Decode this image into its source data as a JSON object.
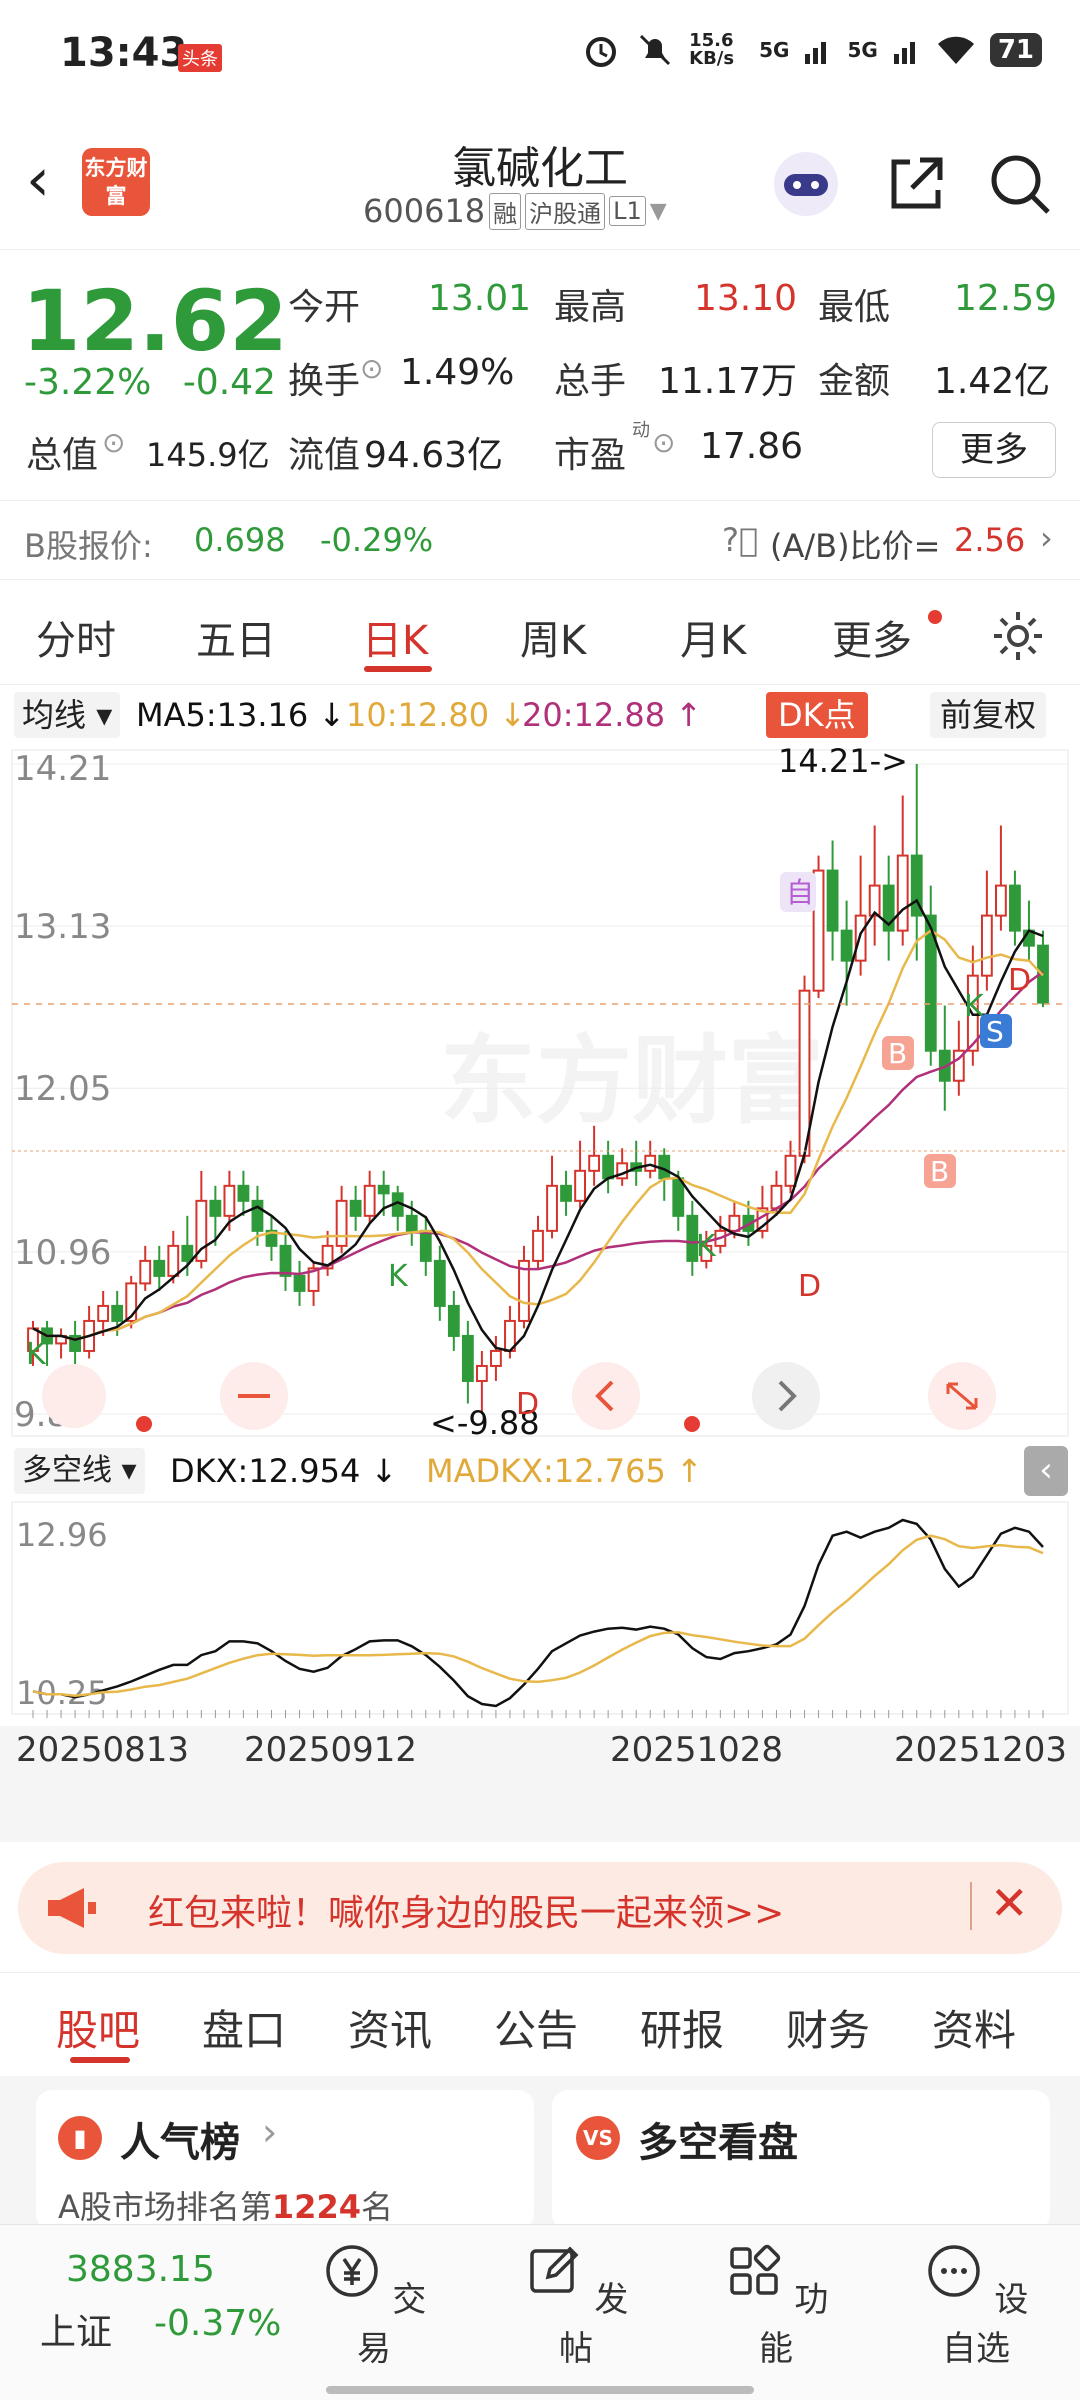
{
  "status": {
    "time": "13:43",
    "badge": "头条",
    "net_speed": "15.6 KB/s",
    "signal1": "5G",
    "signal2": "5G",
    "battery": "71"
  },
  "header": {
    "logo_text": "东方财富",
    "title": "氯碱化工",
    "code": "600618",
    "tag1": "融",
    "tag2": "沪股通",
    "tag3": "L1"
  },
  "quote": {
    "price": "12.62",
    "change_pct": "-3.22%",
    "change_amt": "-0.42",
    "open_label": "今开",
    "open": "13.01",
    "high_label": "最高",
    "high": "13.10",
    "low_label": "最低",
    "low": "12.59",
    "turnover_label": "换手",
    "turnover": "1.49%",
    "volume_label": "总手",
    "volume": "11.17万",
    "amount_label": "金额",
    "amount": "1.42亿",
    "mcap_label": "总值",
    "mcap": "145.9亿",
    "float_label": "流值",
    "float": "94.63亿",
    "pe_label": "市盈",
    "pe_sup": "动",
    "pe": "17.86",
    "more": "更多"
  },
  "bshare": {
    "label": "B股报价:",
    "price": "0.698",
    "change": "-0.29%",
    "ratio_label": "(A/B)比价=",
    "ratio": "2.56"
  },
  "tabs": [
    "分时",
    "五日",
    "日K",
    "周K",
    "月K",
    "更多"
  ],
  "legend": {
    "select": "均线",
    "ma5": "MA5:13.16 ↓",
    "ma10": "10:12.80 ↓",
    "ma20": "20:12.88 ↑",
    "dk": "DK点",
    "fq": "前复权"
  },
  "colors": {
    "red": "#d4342c",
    "green": "#2f9a3a",
    "ma5": "#111111",
    "ma10": "#e8b84a",
    "ma20": "#b0307a"
  },
  "chart_data": {
    "type": "candlestick",
    "y_ticks": [
      "14.21",
      "13.13",
      "12.05",
      "10.96",
      "9.88"
    ],
    "ylim": [
      9.88,
      14.21
    ],
    "annotations": {
      "high": "14.21->",
      "low": "<-9.88",
      "marker_self": "自"
    },
    "signals": [
      "K",
      "D",
      "K",
      "D",
      "K",
      "D",
      "B",
      "K",
      "D",
      "S",
      "B"
    ],
    "dates": [
      "20250813",
      "20250912",
      "20251028",
      "20251203"
    ],
    "indicator": {
      "select": "多空线",
      "dkx_label": "DKX:12.954 ↓",
      "madkx_label": "MADKX:12.765 ↑",
      "y_ticks": [
        "12.96",
        "10.25"
      ]
    },
    "candles": [
      [
        10.3,
        10.45,
        10.2,
        10.5
      ],
      [
        10.45,
        10.35,
        10.2,
        10.5
      ],
      [
        10.35,
        10.4,
        10.25,
        10.45
      ],
      [
        10.4,
        10.3,
        10.2,
        10.5
      ],
      [
        10.3,
        10.5,
        10.25,
        10.6
      ],
      [
        10.5,
        10.6,
        10.4,
        10.7
      ],
      [
        10.6,
        10.5,
        10.4,
        10.7
      ],
      [
        10.5,
        10.75,
        10.45,
        10.8
      ],
      [
        10.75,
        10.9,
        10.7,
        11.0
      ],
      [
        10.9,
        10.8,
        10.7,
        11.0
      ],
      [
        10.8,
        11.0,
        10.75,
        11.1
      ],
      [
        11.0,
        10.9,
        10.8,
        11.2
      ],
      [
        10.9,
        11.3,
        10.85,
        11.5
      ],
      [
        11.3,
        11.2,
        11.0,
        11.4
      ],
      [
        11.2,
        11.4,
        11.1,
        11.5
      ],
      [
        11.4,
        11.3,
        11.2,
        11.5
      ],
      [
        11.3,
        11.1,
        11.0,
        11.4
      ],
      [
        11.1,
        11.0,
        10.9,
        11.2
      ],
      [
        11.0,
        10.8,
        10.7,
        11.1
      ],
      [
        10.8,
        10.7,
        10.6,
        10.9
      ],
      [
        10.7,
        10.85,
        10.6,
        10.9
      ],
      [
        10.85,
        11.0,
        10.8,
        11.1
      ],
      [
        11.0,
        11.3,
        10.95,
        11.4
      ],
      [
        11.3,
        11.2,
        11.1,
        11.4
      ],
      [
        11.2,
        11.4,
        11.15,
        11.5
      ],
      [
        11.4,
        11.35,
        11.2,
        11.5
      ],
      [
        11.35,
        11.2,
        11.1,
        11.4
      ],
      [
        11.2,
        11.1,
        11.0,
        11.3
      ],
      [
        11.1,
        10.9,
        10.8,
        11.2
      ],
      [
        10.9,
        10.6,
        10.5,
        11.0
      ],
      [
        10.6,
        10.4,
        10.3,
        10.7
      ],
      [
        10.4,
        10.1,
        9.95,
        10.5
      ],
      [
        10.1,
        10.2,
        9.88,
        10.3
      ],
      [
        10.2,
        10.3,
        10.1,
        10.4
      ],
      [
        10.3,
        10.5,
        10.25,
        10.6
      ],
      [
        10.5,
        10.9,
        10.45,
        11.0
      ],
      [
        10.9,
        11.1,
        10.85,
        11.2
      ],
      [
        11.1,
        11.4,
        11.05,
        11.6
      ],
      [
        11.4,
        11.3,
        11.2,
        11.5
      ],
      [
        11.3,
        11.5,
        11.25,
        11.7
      ],
      [
        11.5,
        11.6,
        11.4,
        11.8
      ],
      [
        11.6,
        11.45,
        11.35,
        11.7
      ],
      [
        11.45,
        11.55,
        11.4,
        11.65
      ],
      [
        11.55,
        11.5,
        11.4,
        11.7
      ],
      [
        11.5,
        11.6,
        11.45,
        11.7
      ],
      [
        11.6,
        11.45,
        11.3,
        11.65
      ],
      [
        11.45,
        11.2,
        11.1,
        11.5
      ],
      [
        11.2,
        10.9,
        10.8,
        11.3
      ],
      [
        10.9,
        11.0,
        10.85,
        11.1
      ],
      [
        11.0,
        11.1,
        10.95,
        11.2
      ],
      [
        11.1,
        11.2,
        11.05,
        11.3
      ],
      [
        11.2,
        11.1,
        11.0,
        11.3
      ],
      [
        11.1,
        11.25,
        11.05,
        11.4
      ],
      [
        11.25,
        11.4,
        11.2,
        11.5
      ],
      [
        11.4,
        11.6,
        11.35,
        11.7
      ],
      [
        11.6,
        12.7,
        11.55,
        12.8
      ],
      [
        12.7,
        13.5,
        12.65,
        13.6
      ],
      [
        13.5,
        13.1,
        12.9,
        13.7
      ],
      [
        13.1,
        12.9,
        12.6,
        13.3
      ],
      [
        12.9,
        13.2,
        12.8,
        13.6
      ],
      [
        13.2,
        13.4,
        13.0,
        13.8
      ],
      [
        13.4,
        13.1,
        12.9,
        13.6
      ],
      [
        13.1,
        13.6,
        13.0,
        14.0
      ],
      [
        13.6,
        13.2,
        12.9,
        14.21
      ],
      [
        13.2,
        12.3,
        12.2,
        13.4
      ],
      [
        12.3,
        12.1,
        11.9,
        12.6
      ],
      [
        12.1,
        12.3,
        12.0,
        12.5
      ],
      [
        12.3,
        12.8,
        12.2,
        13.0
      ],
      [
        12.8,
        13.2,
        12.7,
        13.5
      ],
      [
        13.2,
        13.4,
        13.1,
        13.8
      ],
      [
        13.4,
        13.1,
        13.0,
        13.5
      ],
      [
        13.1,
        13.0,
        12.9,
        13.3
      ],
      [
        13.0,
        12.62,
        12.59,
        13.1
      ]
    ]
  },
  "banner": {
    "text": "红包来啦！喊你身边的股民一起来领>>"
  },
  "bottom_tabs": [
    "股吧",
    "盘口",
    "资讯",
    "公告",
    "研报",
    "财务",
    "资料"
  ],
  "cards": {
    "left_title": "人气榜",
    "left_sub_prefix": "A股市场排名第",
    "left_rank": "1224",
    "left_sub_suffix": "名",
    "right_title": "多空看盘"
  },
  "nav": {
    "index_value": "3883.15",
    "index_name": "上证",
    "index_change": "-0.37%",
    "items": [
      "交易",
      "发帖",
      "功能",
      "设自选"
    ]
  }
}
